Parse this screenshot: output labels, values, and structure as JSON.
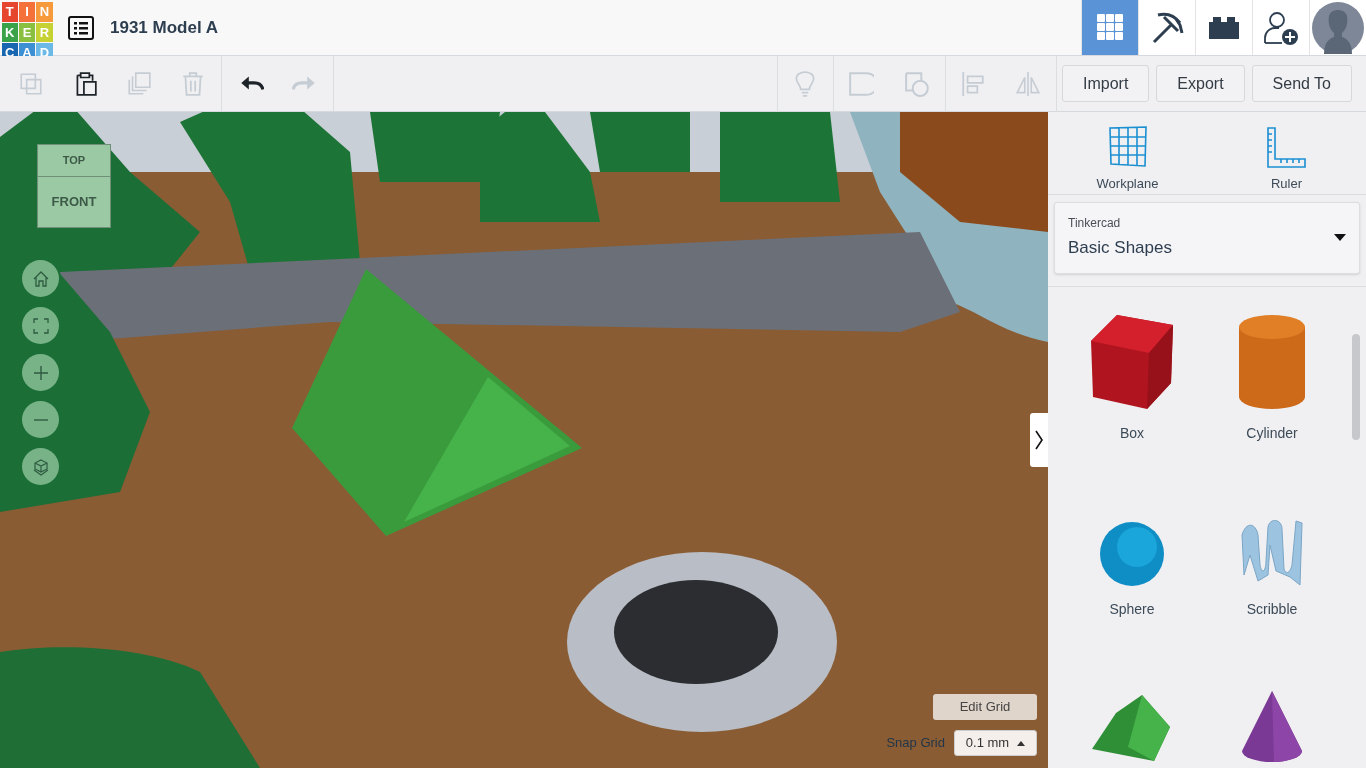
{
  "logo": {
    "letters": [
      "T",
      "I",
      "N",
      "K",
      "E",
      "R",
      "C",
      "A",
      "D"
    ]
  },
  "design_title": "1931 Model A",
  "view_modes": [
    {
      "kind": "grid",
      "selected": true
    },
    {
      "kind": "pickaxe",
      "selected": false
    },
    {
      "kind": "brick",
      "selected": false
    }
  ],
  "edit_tools": [
    {
      "kind": "copy",
      "disabled": true
    },
    {
      "kind": "paste",
      "disabled": false
    },
    {
      "kind": "duplicate",
      "disabled": true
    },
    {
      "kind": "delete",
      "disabled": true
    }
  ],
  "history_tools": [
    {
      "kind": "undo",
      "disabled": false
    },
    {
      "kind": "redo",
      "disabled": true
    }
  ],
  "shape_tools": [
    {
      "kind": "note",
      "disabled": true
    },
    {
      "kind": "group",
      "disabled": true
    },
    {
      "kind": "ungroup",
      "disabled": true
    },
    {
      "kind": "align",
      "disabled": true
    },
    {
      "kind": "mirror",
      "disabled": true
    }
  ],
  "action_buttons": [
    "Import",
    "Export",
    "Send To"
  ],
  "view_cube": {
    "top": "TOP",
    "front": "FRONT"
  },
  "grid": {
    "edit_button": "Edit Grid",
    "snap_label": "Snap Grid",
    "snap_value": "0.1 mm"
  },
  "panel_tools": [
    {
      "kind": "workplane",
      "label": "Workplane"
    },
    {
      "kind": "ruler",
      "label": "Ruler"
    }
  ],
  "library": {
    "group": "Tinkercad",
    "name": "Basic Shapes"
  },
  "shapes": [
    {
      "kind": "box",
      "label": "Box"
    },
    {
      "kind": "cylinder",
      "label": "Cylinder"
    },
    {
      "kind": "sphere",
      "label": "Sphere"
    },
    {
      "kind": "scribble",
      "label": "Scribble"
    },
    {
      "kind": "roof"
    },
    {
      "kind": "cone"
    }
  ]
}
